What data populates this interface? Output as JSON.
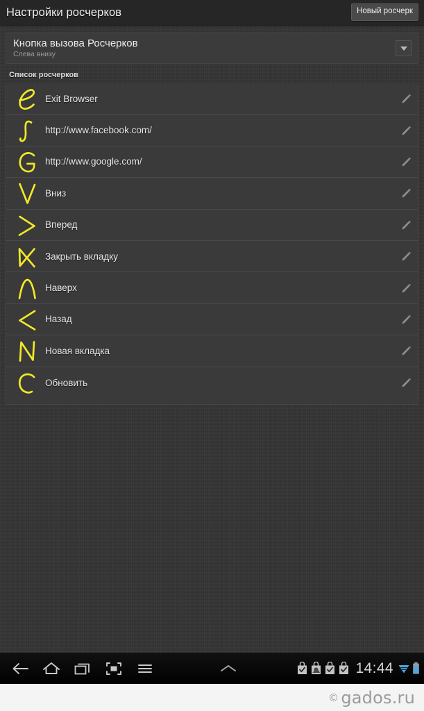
{
  "titlebar": {
    "title": "Настройки росчерков",
    "new_button_label": "Новый росчерк"
  },
  "preference": {
    "title": "Кнопка вызова Росчерков",
    "subtitle": "Слева внизу",
    "arrow_icon": "chevron-down-icon"
  },
  "section": {
    "header": "Список росчерков"
  },
  "gestures": [
    {
      "glyph": "gesture-e",
      "label": "Exit Browser"
    },
    {
      "glyph": "gesture-integral",
      "label": "http://www.facebook.com/"
    },
    {
      "glyph": "gesture-g",
      "label": "http://www.google.com/"
    },
    {
      "glyph": "gesture-v-down",
      "label": "Вниз"
    },
    {
      "glyph": "gesture-arrow-right",
      "label": "Вперед"
    },
    {
      "glyph": "gesture-x-close",
      "label": "Закрыть вкладку"
    },
    {
      "glyph": "gesture-caret-up",
      "label": "Наверх"
    },
    {
      "glyph": "gesture-arrow-left",
      "label": "Назад"
    },
    {
      "glyph": "gesture-n",
      "label": "Новая вкладка"
    },
    {
      "glyph": "gesture-c-reload",
      "label": "Обновить"
    }
  ],
  "row_edit_icon": "pencil-edit-icon",
  "navbar": {
    "buttons": [
      {
        "icon": "back-arrow-icon"
      },
      {
        "icon": "home-icon"
      },
      {
        "icon": "recent-apps-icon"
      },
      {
        "icon": "screenshot-icon"
      },
      {
        "icon": "menu-icon"
      }
    ],
    "expand_icon": "chevron-up-icon",
    "status_icons": [
      "play-store-download-icon",
      "play-store-downloading-icon",
      "play-store-download-icon",
      "play-store-download-icon"
    ],
    "clock": "14:44",
    "wifi_icon": "wifi-icon",
    "battery_icon": "battery-icon"
  },
  "watermark": {
    "copyright": "©",
    "text": "gados.ru"
  },
  "colors": {
    "gesture_stroke": "#f2e828",
    "accent_blue": "#4aa8e0",
    "app_background": "#343434",
    "card_background": "#3a3a3a",
    "titlebar_background": "#262626"
  }
}
